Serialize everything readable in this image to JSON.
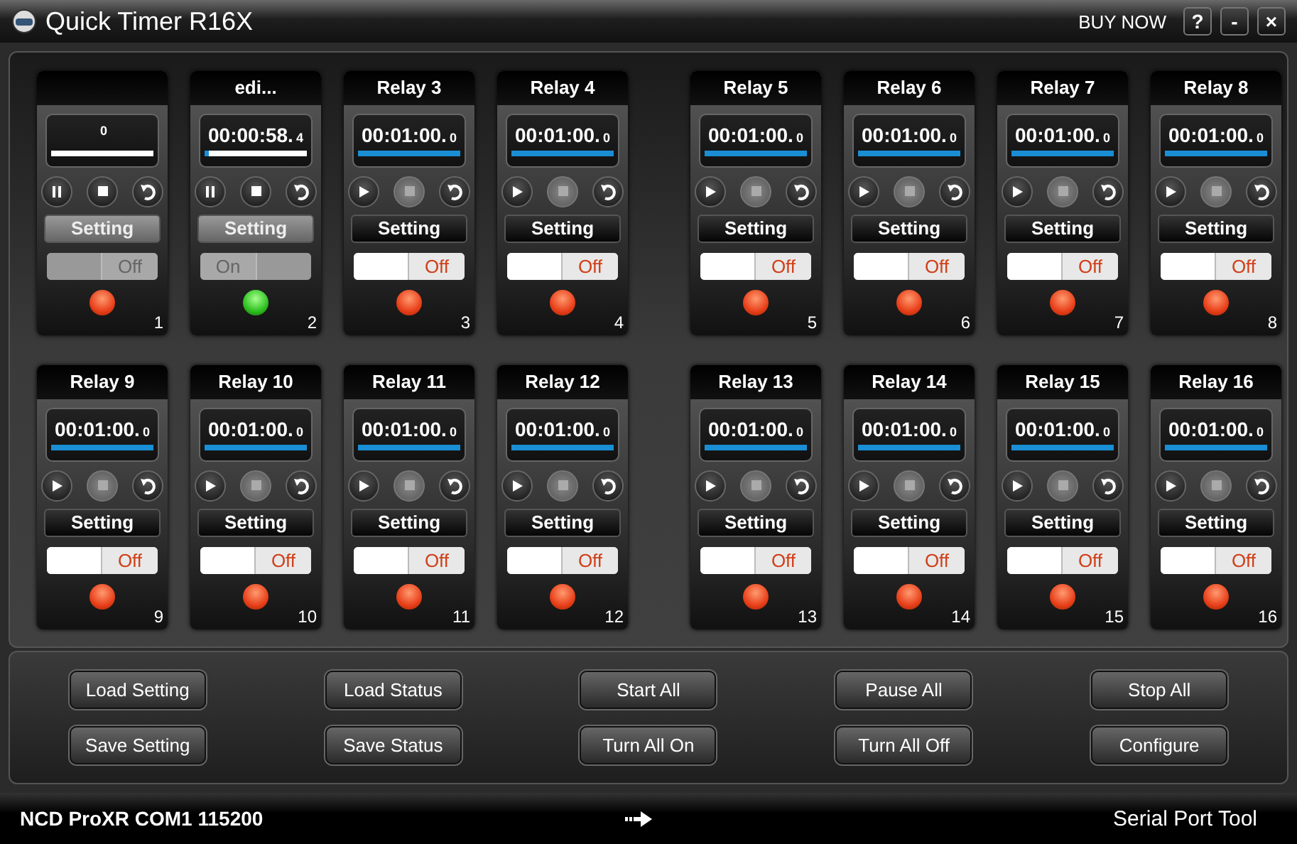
{
  "window": {
    "title": "Quick Timer R16X",
    "buy_now": "BUY NOW",
    "controls": [
      "?",
      "-",
      "×"
    ]
  },
  "relays": [
    {
      "tenths": "0",
      "level": 0,
      "running": true,
      "setting": "Setting",
      "switch_on": false,
      "switch_disabled": true,
      "switch_label": "Off",
      "lamp_on": false,
      "number": "1"
    },
    {
      "title": "edi...",
      "time": "00:00:58.",
      "tenths": "4",
      "level": 0.04,
      "running": true,
      "setting": "Setting",
      "switch_on": true,
      "switch_disabled": true,
      "switch_label": "On",
      "lamp_on": true,
      "number": "2"
    },
    {
      "title": "Relay 3",
      "time": "00:01:00.",
      "tenths": "0",
      "level": 1,
      "running": false,
      "setting": "Setting",
      "switch_on": false,
      "switch_disabled": false,
      "switch_label": "Off",
      "lamp_on": false,
      "number": "3"
    },
    {
      "title": "Relay 4",
      "time": "00:01:00.",
      "tenths": "0",
      "level": 1,
      "running": false,
      "setting": "Setting",
      "switch_on": false,
      "switch_disabled": false,
      "switch_label": "Off",
      "lamp_on": false,
      "number": "4"
    },
    {
      "title": "Relay 5",
      "time": "00:01:00.",
      "tenths": "0",
      "level": 1,
      "running": false,
      "setting": "Setting",
      "switch_on": false,
      "switch_disabled": false,
      "switch_label": "Off",
      "lamp_on": false,
      "number": "5"
    },
    {
      "title": "Relay 6",
      "time": "00:01:00.",
      "tenths": "0",
      "level": 1,
      "running": false,
      "setting": "Setting",
      "switch_on": false,
      "switch_disabled": false,
      "switch_label": "Off",
      "lamp_on": false,
      "number": "6"
    },
    {
      "title": "Relay 7",
      "time": "00:01:00.",
      "tenths": "0",
      "level": 1,
      "running": false,
      "setting": "Setting",
      "switch_on": false,
      "switch_disabled": false,
      "switch_label": "Off",
      "lamp_on": false,
      "number": "7"
    },
    {
      "title": "Relay 8",
      "time": "00:01:00.",
      "tenths": "0",
      "level": 1,
      "running": false,
      "setting": "Setting",
      "switch_on": false,
      "switch_disabled": false,
      "switch_label": "Off",
      "lamp_on": false,
      "number": "8"
    },
    {
      "title": "Relay 9",
      "time": "00:01:00.",
      "tenths": "0",
      "level": 1,
      "running": false,
      "setting": "Setting",
      "switch_on": false,
      "switch_disabled": false,
      "switch_label": "Off",
      "lamp_on": false,
      "number": "9"
    },
    {
      "title": "Relay 10",
      "time": "00:01:00.",
      "tenths": "0",
      "level": 1,
      "running": false,
      "setting": "Setting",
      "switch_on": false,
      "switch_disabled": false,
      "switch_label": "Off",
      "lamp_on": false,
      "number": "10"
    },
    {
      "title": "Relay 11",
      "time": "00:01:00.",
      "tenths": "0",
      "level": 1,
      "running": false,
      "setting": "Setting",
      "switch_on": false,
      "switch_disabled": false,
      "switch_label": "Off",
      "lamp_on": false,
      "number": "11"
    },
    {
      "title": "Relay 12",
      "time": "00:01:00.",
      "tenths": "0",
      "level": 1,
      "running": false,
      "setting": "Setting",
      "switch_on": false,
      "switch_disabled": false,
      "switch_label": "Off",
      "lamp_on": false,
      "number": "12"
    },
    {
      "title": "Relay 13",
      "time": "00:01:00.",
      "tenths": "0",
      "level": 1,
      "running": false,
      "setting": "Setting",
      "switch_on": false,
      "switch_disabled": false,
      "switch_label": "Off",
      "lamp_on": false,
      "number": "13"
    },
    {
      "title": "Relay 14",
      "time": "00:01:00.",
      "tenths": "0",
      "level": 1,
      "running": false,
      "setting": "Setting",
      "switch_on": false,
      "switch_disabled": false,
      "switch_label": "Off",
      "lamp_on": false,
      "number": "14"
    },
    {
      "title": "Relay 15",
      "time": "00:01:00.",
      "tenths": "0",
      "level": 1,
      "running": false,
      "setting": "Setting",
      "switch_on": false,
      "switch_disabled": false,
      "switch_label": "Off",
      "lamp_on": false,
      "number": "15"
    },
    {
      "title": "Relay 16",
      "time": "00:01:00.",
      "tenths": "0",
      "level": 1,
      "running": false,
      "setting": "Setting",
      "switch_on": false,
      "switch_disabled": false,
      "switch_label": "Off",
      "lamp_on": false,
      "number": "16"
    }
  ],
  "buttons": [
    "Load Setting",
    "Load Status",
    "Start All",
    "Pause All",
    "Stop All",
    "Save Setting",
    "Save Status",
    "Turn All On",
    "Turn All Off",
    "Configure"
  ],
  "status_bar": {
    "connection": "NCD ProXR COM1 115200",
    "tool": "Serial Port Tool"
  }
}
